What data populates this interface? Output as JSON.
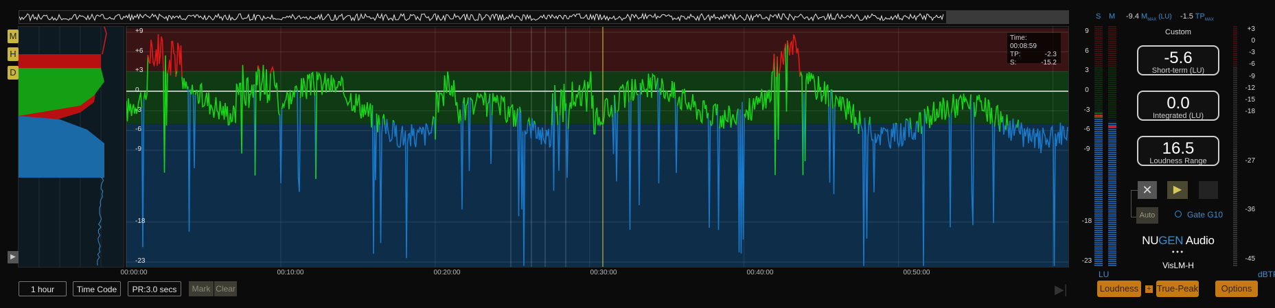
{
  "histogram_buttons": [
    "M",
    "H",
    "D"
  ],
  "main_y_ticks": [
    {
      "v": 9,
      "label": "+9"
    },
    {
      "v": 6,
      "label": "+6"
    },
    {
      "v": 3,
      "label": "+3"
    },
    {
      "v": 0,
      "label": "0"
    },
    {
      "v": -3,
      "label": "-3"
    },
    {
      "v": -6,
      "label": "-6"
    },
    {
      "v": -9,
      "label": "-9"
    },
    {
      "v": -18,
      "label": "-18"
    },
    {
      "v": -23,
      "label": "-23"
    }
  ],
  "x_ticks": [
    "00:00:00",
    "00:10:00",
    "00:20:00",
    "00:30:00",
    "00:40:00",
    "00:50:00"
  ],
  "readout": {
    "time_label": "Time:",
    "time_value": "00:08:59",
    "tp_label": "TP:",
    "tp_value": "-2.3",
    "s_label": "S:",
    "s_value": "-15.2"
  },
  "bottom_controls": {
    "range": "1 hour",
    "timecode": "Time Code",
    "pr": "PR:3.0 secs",
    "mark": "Mark",
    "clear": "Clear"
  },
  "meter_headers": {
    "s": "S",
    "m": "M"
  },
  "meter_scale": [
    {
      "v": 9,
      "label": "9"
    },
    {
      "v": 6,
      "label": "6"
    },
    {
      "v": 3,
      "label": "3"
    },
    {
      "v": 0,
      "label": "0"
    },
    {
      "v": -3,
      "label": "-3"
    },
    {
      "v": -6,
      "label": "-6"
    },
    {
      "v": -9,
      "label": "-9"
    },
    {
      "v": -18,
      "label": "-18"
    },
    {
      "v": -23,
      "label": "-23"
    }
  ],
  "meter_unit": "LU",
  "meter_levels": {
    "s": -3.9,
    "m": -5.6
  },
  "max_readouts": {
    "m_value": "-9.4",
    "m_label": "M",
    "m_sub": "MAX",
    "m_unit": "(LU)",
    "tp_value": "-1.5",
    "tp_label": "TP",
    "tp_sub": "MAX"
  },
  "preset": "Custom",
  "readouts": [
    {
      "value": "-5.6",
      "label": "Short-term (LU)"
    },
    {
      "value": "0.0",
      "label": "Integrated (LU)"
    },
    {
      "value": "16.5",
      "label": "Loudness Range"
    }
  ],
  "transport": {
    "auto": "Auto",
    "gate": "Gate G10"
  },
  "brand": {
    "nu": "NU",
    "gen": "GEN",
    "audio": " Audio",
    "dots": "●●●",
    "product": "VisLM-H"
  },
  "tp_scale": [
    {
      "v": 3,
      "label": "+3"
    },
    {
      "v": 0,
      "label": "0"
    },
    {
      "v": -3,
      "label": "-3"
    },
    {
      "v": -6,
      "label": "-6"
    },
    {
      "v": -9,
      "label": "-9"
    },
    {
      "v": -12,
      "label": "-12"
    },
    {
      "v": -15,
      "label": "-15"
    },
    {
      "v": -18,
      "label": "-18"
    },
    {
      "v": -27,
      "label": "-27"
    },
    {
      "v": -36,
      "label": "-36"
    },
    {
      "v": -45,
      "label": "-45"
    }
  ],
  "tp_unit": "dBTP",
  "footer_buttons": {
    "loudness": "Loudness",
    "plus": "+",
    "truepeak": "True-Peak",
    "options": "Options"
  },
  "colors": {
    "red": "#e01818",
    "green": "#18d418",
    "blue": "#1a78c8",
    "accent": "#c57a14",
    "cyan": "#3a8fd0"
  }
}
